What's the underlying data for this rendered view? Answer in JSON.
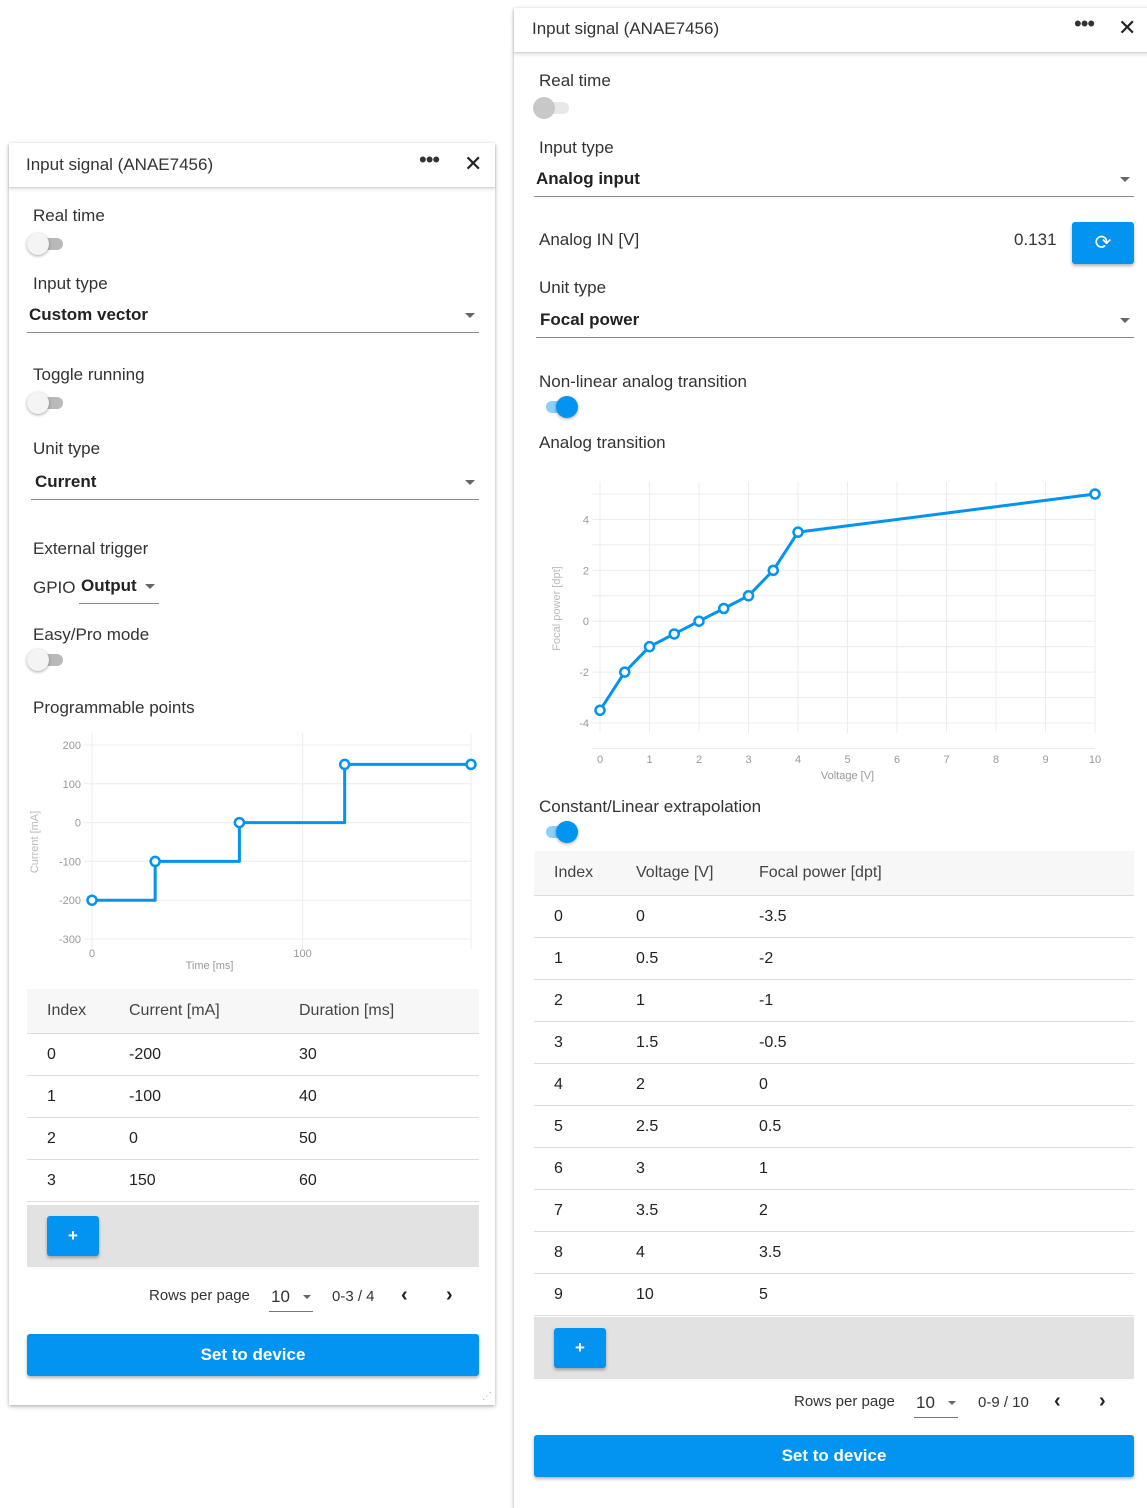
{
  "colors": {
    "accent": "#0393f0",
    "track_on": "#8ccff9",
    "grid": "#ececec"
  },
  "left_panel": {
    "title": "Input signal (ANAE7456)",
    "menu_icon": "more-horizontal-icon",
    "close_icon": "close-icon",
    "real_time": {
      "label": "Real time",
      "on": false
    },
    "input_type": {
      "label": "Input type",
      "value": "Custom vector"
    },
    "toggle_running": {
      "label": "Toggle running",
      "on": false
    },
    "unit_type": {
      "label": "Unit type",
      "value": "Current"
    },
    "external_trigger": {
      "label": "External trigger",
      "gpio_label": "GPIO",
      "gpio_value": "Output"
    },
    "easy_pro": {
      "label": "Easy/Pro mode",
      "on": false
    },
    "programmable_points": {
      "label": "Programmable points"
    },
    "chart_data": {
      "type": "line",
      "step": true,
      "title": "",
      "xlabel": "Time [ms]",
      "ylabel": "Current [mA]",
      "x": [
        0,
        30,
        70,
        120,
        180
      ],
      "y": [
        -200,
        -100,
        0,
        150,
        150
      ],
      "xlim": [
        0,
        180
      ],
      "ylim": [
        -300,
        200
      ],
      "xticks": [
        0,
        100
      ],
      "yticks": [
        -300,
        -200,
        -100,
        0,
        100,
        200
      ],
      "grid": true
    },
    "table": {
      "headers": [
        "Index",
        "Current [mA]",
        "Duration [ms]"
      ],
      "rows": [
        [
          "0",
          "-200",
          "30"
        ],
        [
          "1",
          "-100",
          "40"
        ],
        [
          "2",
          "0",
          "50"
        ],
        [
          "3",
          "150",
          "60"
        ]
      ]
    },
    "add_label": "+",
    "pagination": {
      "rows_per_page_label": "Rows per page",
      "rows_per_page": "10",
      "range": "0-3 / 4",
      "prev": "‹",
      "next": "›"
    },
    "set_button": "Set to device"
  },
  "right_panel": {
    "title": "Input signal (ANAE7456)",
    "menu_icon": "more-horizontal-icon",
    "close_icon": "close-icon",
    "real_time": {
      "label": "Real time",
      "on": false,
      "disabled": true
    },
    "input_type": {
      "label": "Input type",
      "value": "Analog input"
    },
    "analog_in": {
      "label": "Analog IN [V]",
      "value": "0.131",
      "refresh_icon": "refresh-icon"
    },
    "unit_type": {
      "label": "Unit type",
      "value": "Focal power"
    },
    "nonlinear": {
      "label": "Non-linear analog transition",
      "on": true
    },
    "analog_transition": {
      "label": "Analog transition"
    },
    "chart_data": {
      "type": "line",
      "title": "",
      "xlabel": "Voltage [V]",
      "ylabel": "Focal power [dpt]",
      "x": [
        0,
        0.5,
        1,
        1.5,
        2,
        2.5,
        3,
        3.5,
        4,
        10
      ],
      "y": [
        -3.5,
        -2,
        -1,
        -0.5,
        0,
        0.5,
        1,
        2,
        3.5,
        5
      ],
      "xlim": [
        0,
        10
      ],
      "ylim": [
        -4,
        5
      ],
      "xticks": [
        0,
        1,
        2,
        3,
        4,
        5,
        6,
        7,
        8,
        9,
        10
      ],
      "yticks": [
        -4,
        -2,
        0,
        2,
        4
      ],
      "grid": true
    },
    "extrapolation": {
      "label": "Constant/Linear extrapolation",
      "on": true
    },
    "table": {
      "headers": [
        "Index",
        "Voltage [V]",
        "Focal power [dpt]"
      ],
      "rows": [
        [
          "0",
          "0",
          "-3.5"
        ],
        [
          "1",
          "0.5",
          "-2"
        ],
        [
          "2",
          "1",
          "-1"
        ],
        [
          "3",
          "1.5",
          "-0.5"
        ],
        [
          "4",
          "2",
          "0"
        ],
        [
          "5",
          "2.5",
          "0.5"
        ],
        [
          "6",
          "3",
          "1"
        ],
        [
          "7",
          "3.5",
          "2"
        ],
        [
          "8",
          "4",
          "3.5"
        ],
        [
          "9",
          "10",
          "5"
        ]
      ]
    },
    "add_label": "+",
    "pagination": {
      "rows_per_page_label": "Rows per page",
      "rows_per_page": "10",
      "range": "0-9 / 10",
      "prev": "‹",
      "next": "›"
    },
    "set_button": "Set to device"
  }
}
